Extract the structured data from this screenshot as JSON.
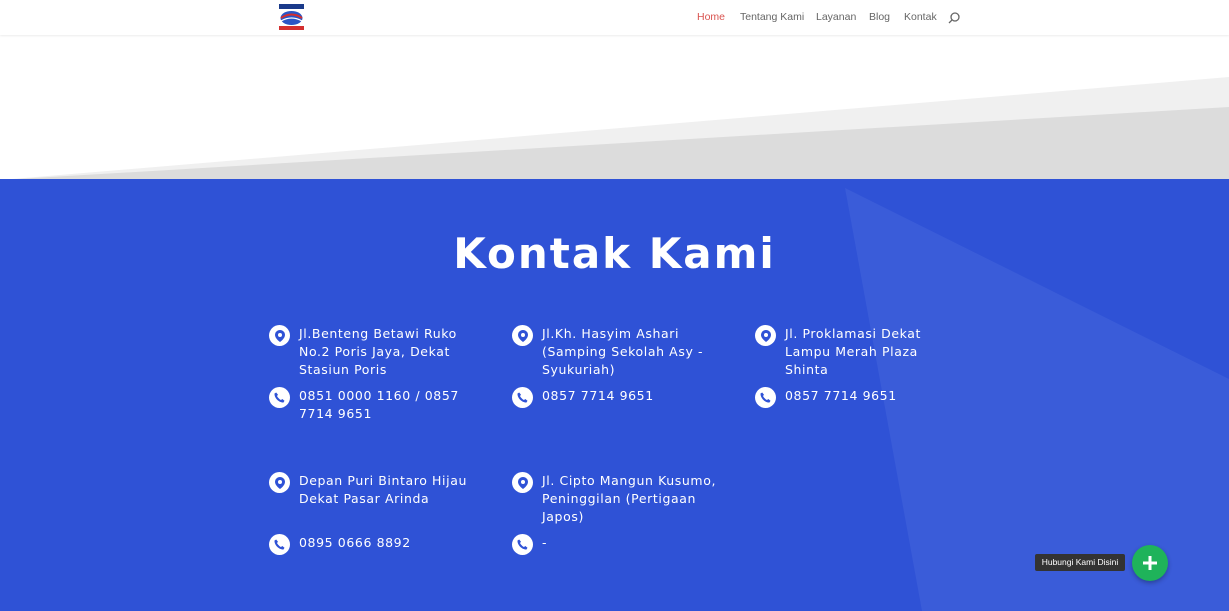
{
  "header": {
    "logo_icon": "company-logo",
    "nav": [
      {
        "label": "Home",
        "active": true
      },
      {
        "label": "Tentang Kami",
        "active": false
      },
      {
        "label": "Layanan",
        "active": false
      },
      {
        "label": "Blog",
        "active": false
      },
      {
        "label": "Kontak",
        "active": false
      }
    ],
    "search_icon": "search-icon",
    "active_color": "#d9534f"
  },
  "contact": {
    "title": "Kontak Kami",
    "background_color": "#2f52d6",
    "locations": [
      {
        "address": "Jl.Benteng Betawi Ruko No.2 Poris Jaya, Dekat Stasiun Poris",
        "phone": "0851 0000 1160 / 0857 7714 9651"
      },
      {
        "address": "Jl.Kh. Hasyim Ashari (Samping Sekolah Asy - Syukuriah)",
        "phone": "0857 7714 9651"
      },
      {
        "address": "Jl. Proklamasi Dekat Lampu Merah Plaza Shinta",
        "phone": "0857 7714 9651"
      },
      {
        "address": "Depan Puri Bintaro Hijau Dekat Pasar Arinda",
        "phone": "0895 0666 8892"
      },
      {
        "address": "Jl. Cipto Mangun Kusumo, Peninggilan (Pertigaan Japos)",
        "phone": "-"
      }
    ]
  },
  "chat": {
    "label": "Hubungi Kami Disini",
    "button_icon": "plus-icon",
    "button_color": "#1fb35a"
  }
}
